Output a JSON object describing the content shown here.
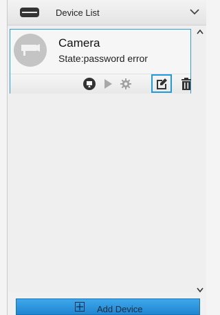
{
  "header": {
    "title": "Device List"
  },
  "devices": [
    {
      "name": "Camera",
      "state": "State:password error"
    }
  ],
  "toolbar": {
    "icons": [
      "live-view-icon",
      "play-icon",
      "settings-icon",
      "edit-icon",
      "delete-icon"
    ],
    "selected": "edit-icon"
  },
  "footer": {
    "add_label": "Add Device"
  },
  "colors": {
    "accent": "#1f9ae0",
    "button": "#2a93dd"
  }
}
